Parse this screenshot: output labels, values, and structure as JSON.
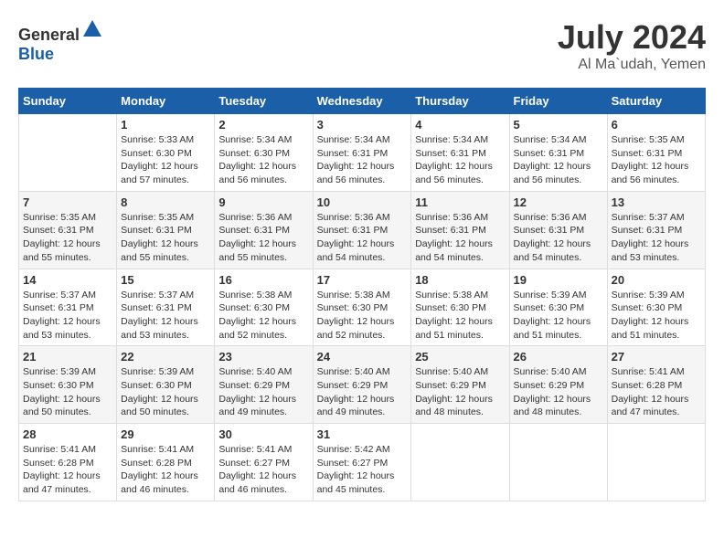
{
  "header": {
    "logo_general": "General",
    "logo_blue": "Blue",
    "month_year": "July 2024",
    "location": "Al Ma`udah, Yemen"
  },
  "calendar": {
    "days_of_week": [
      "Sunday",
      "Monday",
      "Tuesday",
      "Wednesday",
      "Thursday",
      "Friday",
      "Saturday"
    ],
    "weeks": [
      [
        {
          "day": "",
          "info": ""
        },
        {
          "day": "1",
          "info": "Sunrise: 5:33 AM\nSunset: 6:30 PM\nDaylight: 12 hours\nand 57 minutes."
        },
        {
          "day": "2",
          "info": "Sunrise: 5:34 AM\nSunset: 6:30 PM\nDaylight: 12 hours\nand 56 minutes."
        },
        {
          "day": "3",
          "info": "Sunrise: 5:34 AM\nSunset: 6:31 PM\nDaylight: 12 hours\nand 56 minutes."
        },
        {
          "day": "4",
          "info": "Sunrise: 5:34 AM\nSunset: 6:31 PM\nDaylight: 12 hours\nand 56 minutes."
        },
        {
          "day": "5",
          "info": "Sunrise: 5:34 AM\nSunset: 6:31 PM\nDaylight: 12 hours\nand 56 minutes."
        },
        {
          "day": "6",
          "info": "Sunrise: 5:35 AM\nSunset: 6:31 PM\nDaylight: 12 hours\nand 56 minutes."
        }
      ],
      [
        {
          "day": "7",
          "info": "Sunrise: 5:35 AM\nSunset: 6:31 PM\nDaylight: 12 hours\nand 55 minutes."
        },
        {
          "day": "8",
          "info": "Sunrise: 5:35 AM\nSunset: 6:31 PM\nDaylight: 12 hours\nand 55 minutes."
        },
        {
          "day": "9",
          "info": "Sunrise: 5:36 AM\nSunset: 6:31 PM\nDaylight: 12 hours\nand 55 minutes."
        },
        {
          "day": "10",
          "info": "Sunrise: 5:36 AM\nSunset: 6:31 PM\nDaylight: 12 hours\nand 54 minutes."
        },
        {
          "day": "11",
          "info": "Sunrise: 5:36 AM\nSunset: 6:31 PM\nDaylight: 12 hours\nand 54 minutes."
        },
        {
          "day": "12",
          "info": "Sunrise: 5:36 AM\nSunset: 6:31 PM\nDaylight: 12 hours\nand 54 minutes."
        },
        {
          "day": "13",
          "info": "Sunrise: 5:37 AM\nSunset: 6:31 PM\nDaylight: 12 hours\nand 53 minutes."
        }
      ],
      [
        {
          "day": "14",
          "info": "Sunrise: 5:37 AM\nSunset: 6:31 PM\nDaylight: 12 hours\nand 53 minutes."
        },
        {
          "day": "15",
          "info": "Sunrise: 5:37 AM\nSunset: 6:31 PM\nDaylight: 12 hours\nand 53 minutes."
        },
        {
          "day": "16",
          "info": "Sunrise: 5:38 AM\nSunset: 6:30 PM\nDaylight: 12 hours\nand 52 minutes."
        },
        {
          "day": "17",
          "info": "Sunrise: 5:38 AM\nSunset: 6:30 PM\nDaylight: 12 hours\nand 52 minutes."
        },
        {
          "day": "18",
          "info": "Sunrise: 5:38 AM\nSunset: 6:30 PM\nDaylight: 12 hours\nand 51 minutes."
        },
        {
          "day": "19",
          "info": "Sunrise: 5:39 AM\nSunset: 6:30 PM\nDaylight: 12 hours\nand 51 minutes."
        },
        {
          "day": "20",
          "info": "Sunrise: 5:39 AM\nSunset: 6:30 PM\nDaylight: 12 hours\nand 51 minutes."
        }
      ],
      [
        {
          "day": "21",
          "info": "Sunrise: 5:39 AM\nSunset: 6:30 PM\nDaylight: 12 hours\nand 50 minutes."
        },
        {
          "day": "22",
          "info": "Sunrise: 5:39 AM\nSunset: 6:30 PM\nDaylight: 12 hours\nand 50 minutes."
        },
        {
          "day": "23",
          "info": "Sunrise: 5:40 AM\nSunset: 6:29 PM\nDaylight: 12 hours\nand 49 minutes."
        },
        {
          "day": "24",
          "info": "Sunrise: 5:40 AM\nSunset: 6:29 PM\nDaylight: 12 hours\nand 49 minutes."
        },
        {
          "day": "25",
          "info": "Sunrise: 5:40 AM\nSunset: 6:29 PM\nDaylight: 12 hours\nand 48 minutes."
        },
        {
          "day": "26",
          "info": "Sunrise: 5:40 AM\nSunset: 6:29 PM\nDaylight: 12 hours\nand 48 minutes."
        },
        {
          "day": "27",
          "info": "Sunrise: 5:41 AM\nSunset: 6:28 PM\nDaylight: 12 hours\nand 47 minutes."
        }
      ],
      [
        {
          "day": "28",
          "info": "Sunrise: 5:41 AM\nSunset: 6:28 PM\nDaylight: 12 hours\nand 47 minutes."
        },
        {
          "day": "29",
          "info": "Sunrise: 5:41 AM\nSunset: 6:28 PM\nDaylight: 12 hours\nand 46 minutes."
        },
        {
          "day": "30",
          "info": "Sunrise: 5:41 AM\nSunset: 6:27 PM\nDaylight: 12 hours\nand 46 minutes."
        },
        {
          "day": "31",
          "info": "Sunrise: 5:42 AM\nSunset: 6:27 PM\nDaylight: 12 hours\nand 45 minutes."
        },
        {
          "day": "",
          "info": ""
        },
        {
          "day": "",
          "info": ""
        },
        {
          "day": "",
          "info": ""
        }
      ]
    ]
  }
}
